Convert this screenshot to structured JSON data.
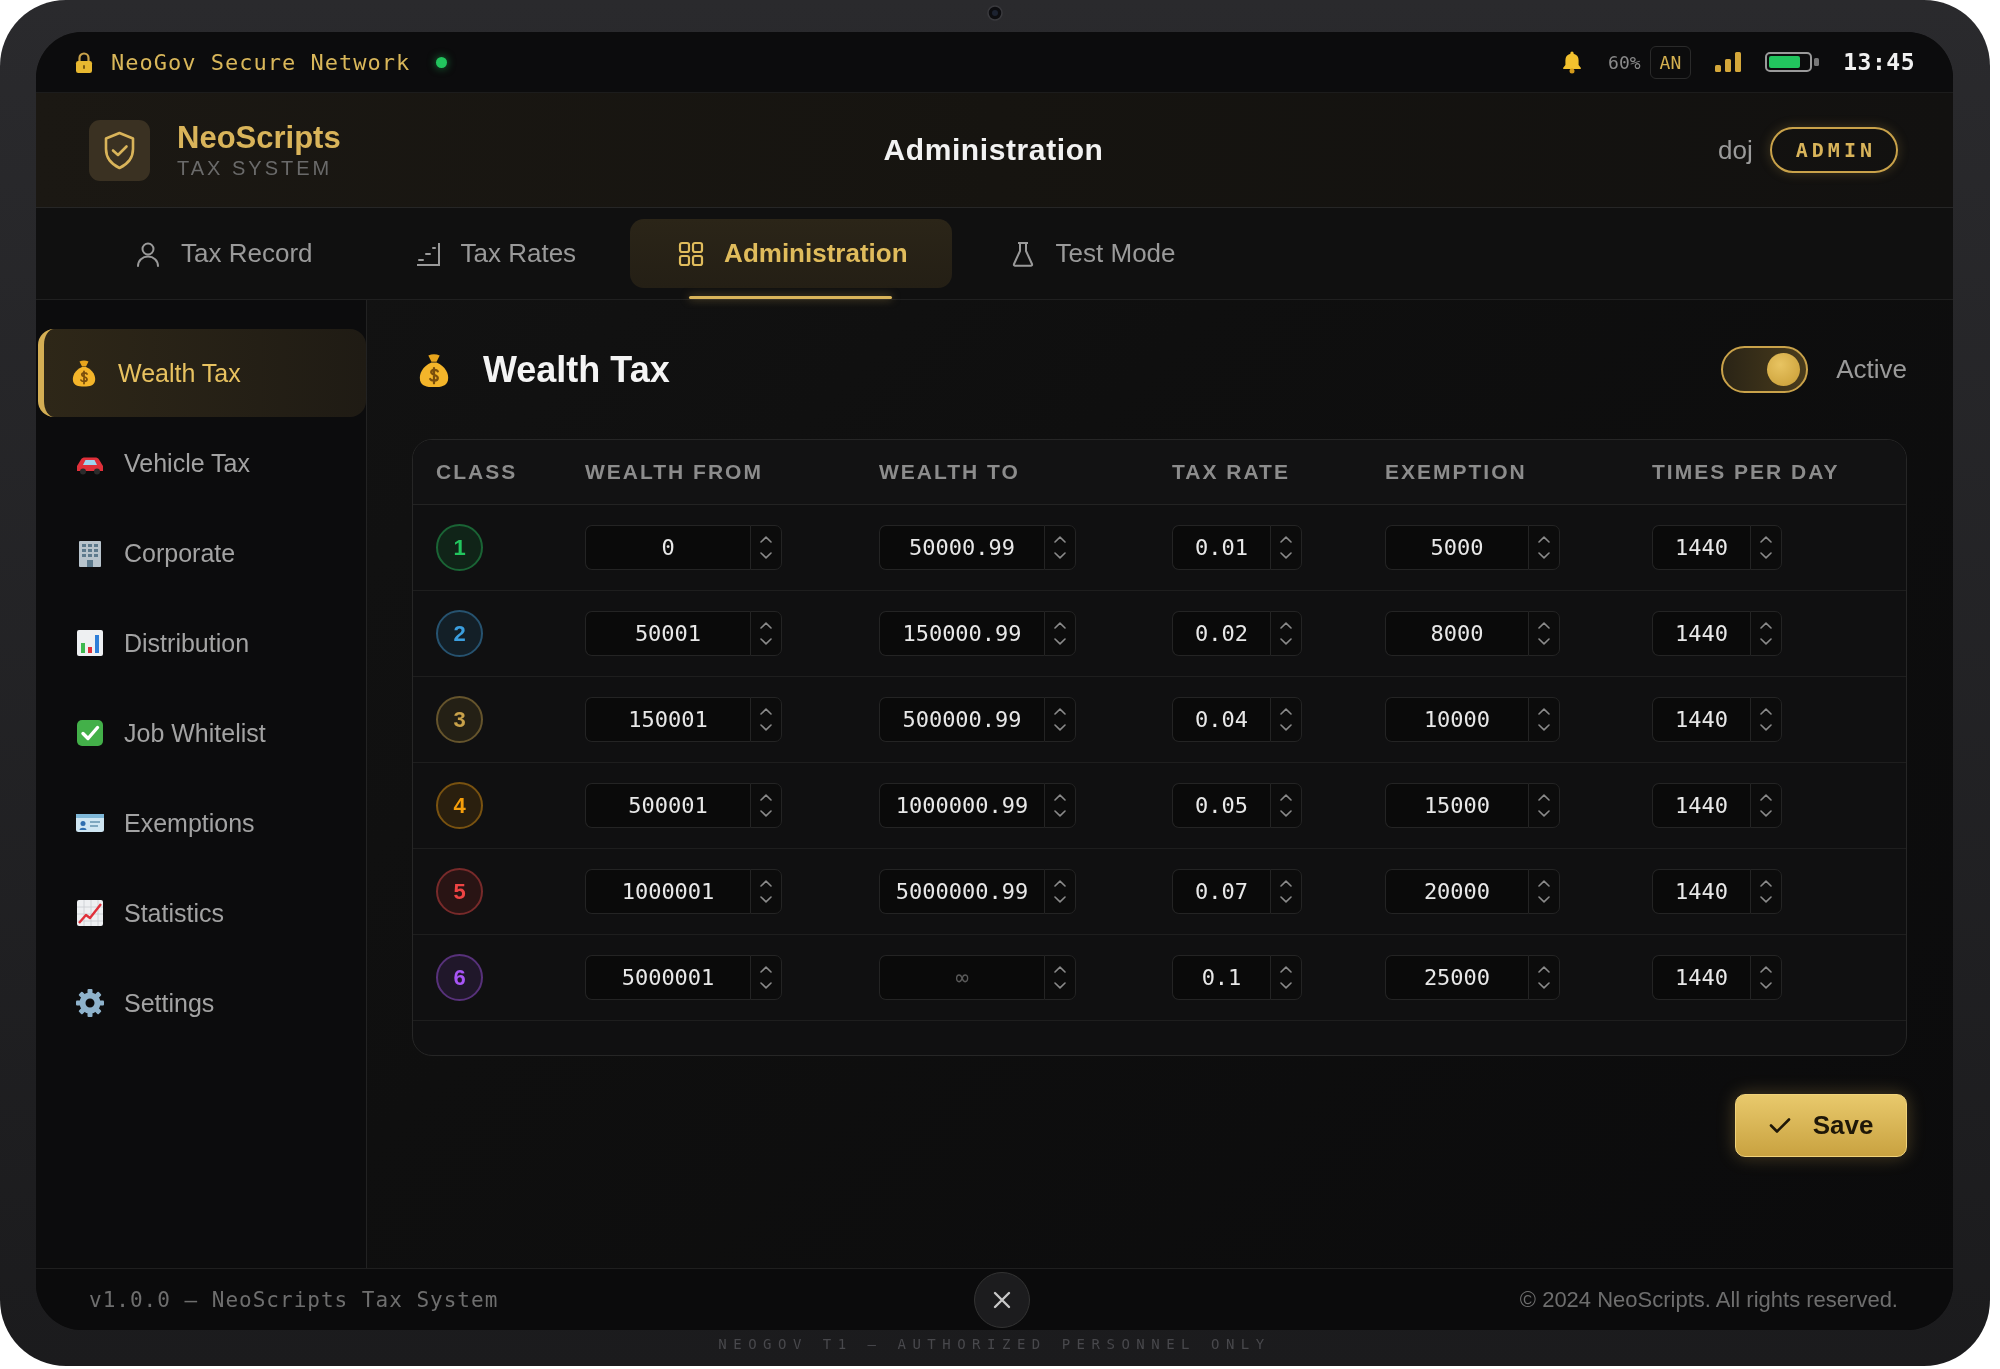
{
  "status_bar": {
    "network": "NeoGov Secure Network",
    "connected": true,
    "percent": "60%",
    "user_initials": "AN",
    "time": "13:45"
  },
  "header": {
    "brand": "NeoScripts",
    "subtitle": "TAX SYSTEM",
    "title": "Administration",
    "user": "doj",
    "role": "ADMIN"
  },
  "tabs": [
    {
      "label": "Tax Record",
      "selected": false
    },
    {
      "label": "Tax Rates",
      "selected": false
    },
    {
      "label": "Administration",
      "selected": true
    },
    {
      "label": "Test Mode",
      "selected": false
    }
  ],
  "sidebar": {
    "items": [
      {
        "label": "Wealth Tax",
        "selected": true
      },
      {
        "label": "Vehicle Tax",
        "selected": false
      },
      {
        "label": "Corporate",
        "selected": false
      },
      {
        "label": "Distribution",
        "selected": false
      },
      {
        "label": "Job Whitelist",
        "selected": false
      },
      {
        "label": "Exemptions",
        "selected": false
      },
      {
        "label": "Statistics",
        "selected": false
      },
      {
        "label": "Settings",
        "selected": false
      }
    ]
  },
  "section": {
    "title": "Wealth Tax",
    "active": true,
    "active_label": "Active"
  },
  "table": {
    "columns": [
      "CLASS",
      "WEALTH FROM",
      "WEALTH TO",
      "TAX RATE",
      "EXEMPTION",
      "TIMES PER DAY"
    ],
    "rows": [
      {
        "class": "1",
        "color": "#22c55e",
        "fields": [
          {
            "value": "0"
          },
          {
            "value": "50000.99"
          },
          {
            "value": "0.01"
          },
          {
            "value": "5000"
          },
          {
            "value": "1440"
          }
        ]
      },
      {
        "class": "2",
        "color": "#3b9ede",
        "fields": [
          {
            "value": "50001"
          },
          {
            "value": "150000.99"
          },
          {
            "value": "0.02"
          },
          {
            "value": "8000"
          },
          {
            "value": "1440"
          }
        ]
      },
      {
        "class": "3",
        "color": "#c9a24a",
        "fields": [
          {
            "value": "150001"
          },
          {
            "value": "500000.99"
          },
          {
            "value": "0.04"
          },
          {
            "value": "10000"
          },
          {
            "value": "1440"
          }
        ]
      },
      {
        "class": "4",
        "color": "#f59e0b",
        "fields": [
          {
            "value": "500001"
          },
          {
            "value": "1000000.99"
          },
          {
            "value": "0.05"
          },
          {
            "value": "15000"
          },
          {
            "value": "1440"
          }
        ]
      },
      {
        "class": "5",
        "color": "#ef4444",
        "fields": [
          {
            "value": "1000001"
          },
          {
            "value": "5000000.99"
          },
          {
            "value": "0.07"
          },
          {
            "value": "20000"
          },
          {
            "value": "1440"
          }
        ]
      },
      {
        "class": "6",
        "color": "#a855f7",
        "fields": [
          {
            "value": "5000001"
          },
          {
            "placeholder": "∞"
          },
          {
            "value": "0.1"
          },
          {
            "value": "25000"
          },
          {
            "value": "1440"
          }
        ]
      }
    ]
  },
  "save_button": "Save",
  "footer": {
    "version": "v1.0.0 — NeoScripts Tax System",
    "copyright": "© 2024 NeoScripts. All rights reserved."
  },
  "device_label": "NEOGOV T1 — AUTHORIZED PERSONNEL ONLY"
}
